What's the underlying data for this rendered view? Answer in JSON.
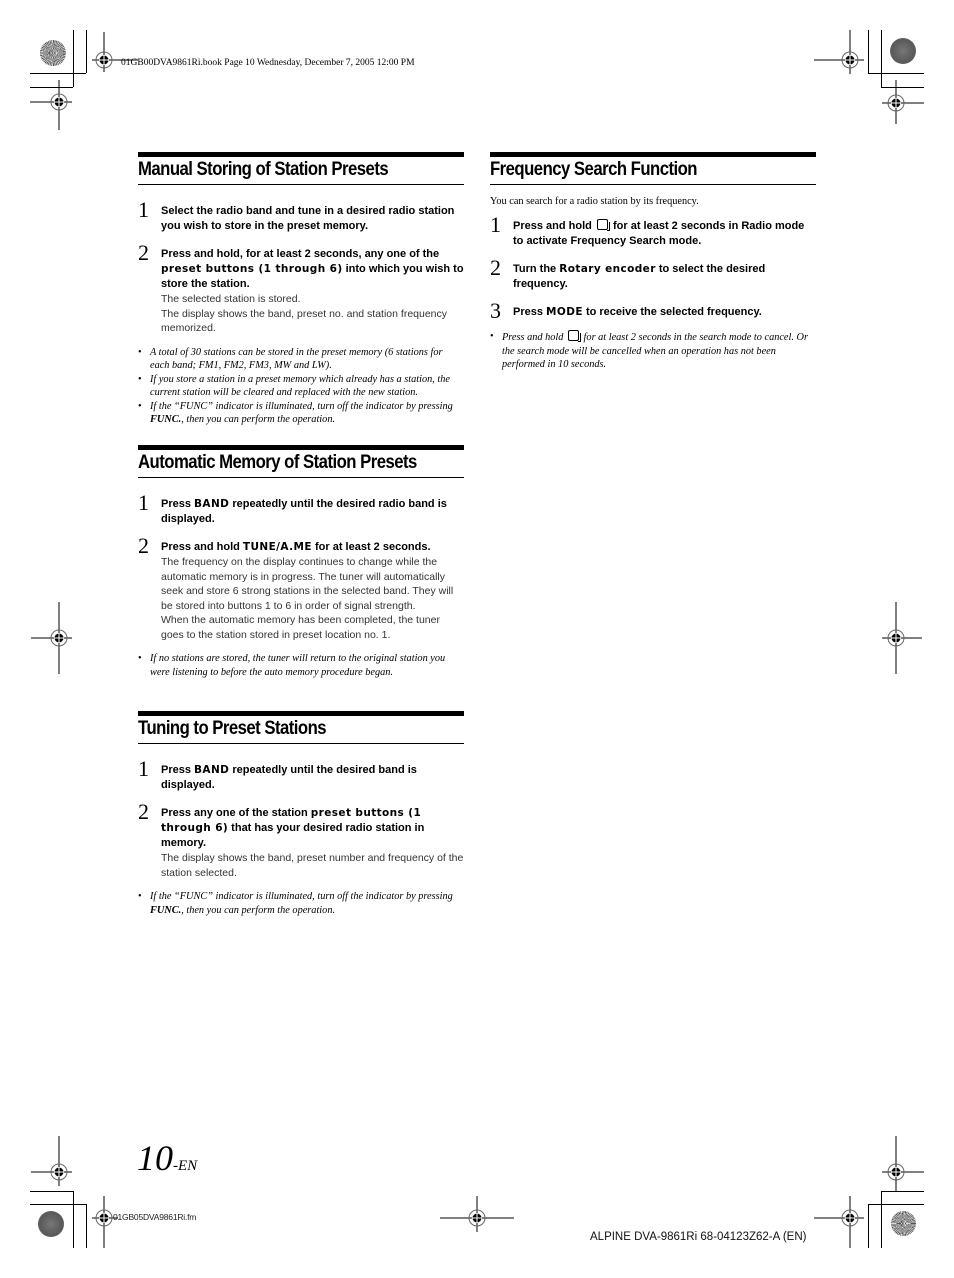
{
  "header": {
    "book_meta": "01GB00DVA9861Ri.book  Page 10  Wednesday, December 7, 2005  12:00 PM"
  },
  "sections": {
    "manual": {
      "title": "Manual Storing of Station Presets",
      "steps": [
        {
          "num": "1",
          "text": "Select the radio band and tune in a desired radio station you wish to store in the preset memory."
        },
        {
          "num": "2",
          "pre": "Press and hold, for at least 2 seconds, any one of the ",
          "key": "preset buttons (1 through 6)",
          "post": " into which you wish to store the station.",
          "desc1": "The selected station is stored.",
          "desc2": "The display shows the band, preset no. and station frequency memorized."
        }
      ],
      "notes": [
        "A total of 30 stations can be stored in the preset memory (6 stations for each band; FM1, FM2, FM3, MW and LW).",
        "If you store a station in a preset memory which already has a station, the current station will be cleared and replaced with the new station."
      ],
      "note3_pre": "If the “FUNC” indicator is illuminated, turn off the indicator by pressing ",
      "note3_key": "FUNC.",
      "note3_post": ", then you can perform the operation."
    },
    "automatic": {
      "title": "Automatic Memory of Station Presets",
      "steps": [
        {
          "num": "1",
          "pre": "Press ",
          "key": "BAND",
          "post": " repeatedly until the desired radio band is displayed."
        },
        {
          "num": "2",
          "pre": "Press and hold ",
          "key": "TUNE/A.ME",
          "post": " for at least 2 seconds.",
          "desc1": "The frequency on the display continues to change while the automatic memory is in progress. The tuner will automatically seek and store 6 strong stations in the selected band. They will be stored into buttons 1 to 6 in order of signal strength.",
          "desc2": "When the automatic memory has been completed, the tuner goes to the station stored in preset location no. 1."
        }
      ],
      "notes": [
        "If no stations are stored, the tuner will return to the original station you were listening to before the auto memory procedure began."
      ]
    },
    "tuning": {
      "title": "Tuning to Preset Stations",
      "steps": [
        {
          "num": "1",
          "pre": "Press ",
          "key": "BAND",
          "post": " repeatedly until the desired band is displayed."
        },
        {
          "num": "2",
          "pre": "Press any one of the station ",
          "key": "preset buttons (1 through 6)",
          "post": " that has your desired radio station in memory.",
          "desc1": "The display shows the band, preset number and frequency of the station selected."
        }
      ],
      "note_pre": "If the “FUNC” indicator is illuminated, turn off the indicator by pressing ",
      "note_key": "FUNC.",
      "note_post": ", then you can perform the operation."
    },
    "frequency": {
      "title": "Frequency Search Function",
      "intro": "You can search for a radio station by its frequency.",
      "steps": [
        {
          "num": "1",
          "pre": "Press and hold ",
          "icon": "search-button-icon",
          "post": " for at least 2 seconds in Radio mode to activate Frequency Search mode."
        },
        {
          "num": "2",
          "pre": "Turn the ",
          "key": "Rotary encoder",
          "post": " to select the desired frequency."
        },
        {
          "num": "3",
          "pre": "Press ",
          "key": "MODE",
          "post": " to receive the selected frequency."
        }
      ],
      "note_pre": "Press and hold ",
      "note_post": " for at least 2 seconds in the search mode to cancel. Or the search mode will be cancelled when an operation has not been performed in 10 seconds."
    }
  },
  "footer": {
    "page_number": "10",
    "page_suffix": "-EN",
    "file_name": "01GB05DVA9861Ri.fm",
    "model_code": "ALPINE DVA-9861Ri 68-04123Z62-A (EN)"
  },
  "bullet": "•"
}
